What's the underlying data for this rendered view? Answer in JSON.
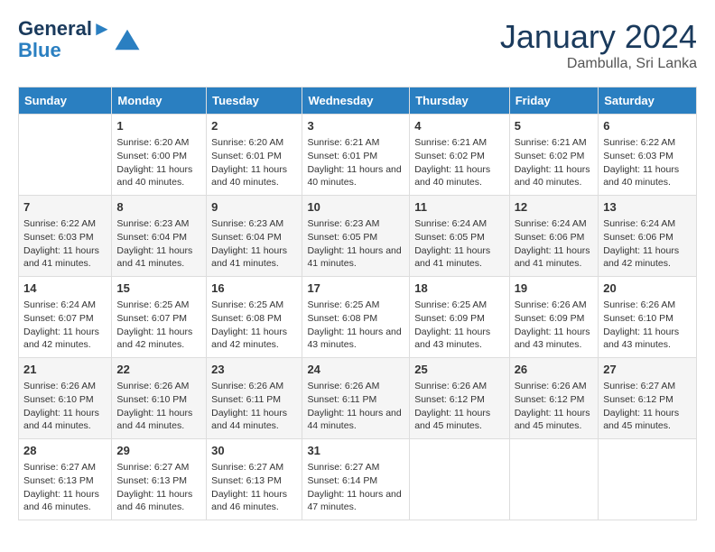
{
  "header": {
    "logo_line1": "General",
    "logo_line2": "Blue",
    "month": "January 2024",
    "location": "Dambulla, Sri Lanka"
  },
  "days_of_week": [
    "Sunday",
    "Monday",
    "Tuesday",
    "Wednesday",
    "Thursday",
    "Friday",
    "Saturday"
  ],
  "weeks": [
    [
      {
        "day": "",
        "info": ""
      },
      {
        "day": "1",
        "info": "Sunrise: 6:20 AM\nSunset: 6:00 PM\nDaylight: 11 hours and 40 minutes."
      },
      {
        "day": "2",
        "info": "Sunrise: 6:20 AM\nSunset: 6:01 PM\nDaylight: 11 hours and 40 minutes."
      },
      {
        "day": "3",
        "info": "Sunrise: 6:21 AM\nSunset: 6:01 PM\nDaylight: 11 hours and 40 minutes."
      },
      {
        "day": "4",
        "info": "Sunrise: 6:21 AM\nSunset: 6:02 PM\nDaylight: 11 hours and 40 minutes."
      },
      {
        "day": "5",
        "info": "Sunrise: 6:21 AM\nSunset: 6:02 PM\nDaylight: 11 hours and 40 minutes."
      },
      {
        "day": "6",
        "info": "Sunrise: 6:22 AM\nSunset: 6:03 PM\nDaylight: 11 hours and 40 minutes."
      }
    ],
    [
      {
        "day": "7",
        "info": "Sunrise: 6:22 AM\nSunset: 6:03 PM\nDaylight: 11 hours and 41 minutes."
      },
      {
        "day": "8",
        "info": "Sunrise: 6:23 AM\nSunset: 6:04 PM\nDaylight: 11 hours and 41 minutes."
      },
      {
        "day": "9",
        "info": "Sunrise: 6:23 AM\nSunset: 6:04 PM\nDaylight: 11 hours and 41 minutes."
      },
      {
        "day": "10",
        "info": "Sunrise: 6:23 AM\nSunset: 6:05 PM\nDaylight: 11 hours and 41 minutes."
      },
      {
        "day": "11",
        "info": "Sunrise: 6:24 AM\nSunset: 6:05 PM\nDaylight: 11 hours and 41 minutes."
      },
      {
        "day": "12",
        "info": "Sunrise: 6:24 AM\nSunset: 6:06 PM\nDaylight: 11 hours and 41 minutes."
      },
      {
        "day": "13",
        "info": "Sunrise: 6:24 AM\nSunset: 6:06 PM\nDaylight: 11 hours and 42 minutes."
      }
    ],
    [
      {
        "day": "14",
        "info": "Sunrise: 6:24 AM\nSunset: 6:07 PM\nDaylight: 11 hours and 42 minutes."
      },
      {
        "day": "15",
        "info": "Sunrise: 6:25 AM\nSunset: 6:07 PM\nDaylight: 11 hours and 42 minutes."
      },
      {
        "day": "16",
        "info": "Sunrise: 6:25 AM\nSunset: 6:08 PM\nDaylight: 11 hours and 42 minutes."
      },
      {
        "day": "17",
        "info": "Sunrise: 6:25 AM\nSunset: 6:08 PM\nDaylight: 11 hours and 43 minutes."
      },
      {
        "day": "18",
        "info": "Sunrise: 6:25 AM\nSunset: 6:09 PM\nDaylight: 11 hours and 43 minutes."
      },
      {
        "day": "19",
        "info": "Sunrise: 6:26 AM\nSunset: 6:09 PM\nDaylight: 11 hours and 43 minutes."
      },
      {
        "day": "20",
        "info": "Sunrise: 6:26 AM\nSunset: 6:10 PM\nDaylight: 11 hours and 43 minutes."
      }
    ],
    [
      {
        "day": "21",
        "info": "Sunrise: 6:26 AM\nSunset: 6:10 PM\nDaylight: 11 hours and 44 minutes."
      },
      {
        "day": "22",
        "info": "Sunrise: 6:26 AM\nSunset: 6:10 PM\nDaylight: 11 hours and 44 minutes."
      },
      {
        "day": "23",
        "info": "Sunrise: 6:26 AM\nSunset: 6:11 PM\nDaylight: 11 hours and 44 minutes."
      },
      {
        "day": "24",
        "info": "Sunrise: 6:26 AM\nSunset: 6:11 PM\nDaylight: 11 hours and 44 minutes."
      },
      {
        "day": "25",
        "info": "Sunrise: 6:26 AM\nSunset: 6:12 PM\nDaylight: 11 hours and 45 minutes."
      },
      {
        "day": "26",
        "info": "Sunrise: 6:26 AM\nSunset: 6:12 PM\nDaylight: 11 hours and 45 minutes."
      },
      {
        "day": "27",
        "info": "Sunrise: 6:27 AM\nSunset: 6:12 PM\nDaylight: 11 hours and 45 minutes."
      }
    ],
    [
      {
        "day": "28",
        "info": "Sunrise: 6:27 AM\nSunset: 6:13 PM\nDaylight: 11 hours and 46 minutes."
      },
      {
        "day": "29",
        "info": "Sunrise: 6:27 AM\nSunset: 6:13 PM\nDaylight: 11 hours and 46 minutes."
      },
      {
        "day": "30",
        "info": "Sunrise: 6:27 AM\nSunset: 6:13 PM\nDaylight: 11 hours and 46 minutes."
      },
      {
        "day": "31",
        "info": "Sunrise: 6:27 AM\nSunset: 6:14 PM\nDaylight: 11 hours and 47 minutes."
      },
      {
        "day": "",
        "info": ""
      },
      {
        "day": "",
        "info": ""
      },
      {
        "day": "",
        "info": ""
      }
    ]
  ]
}
